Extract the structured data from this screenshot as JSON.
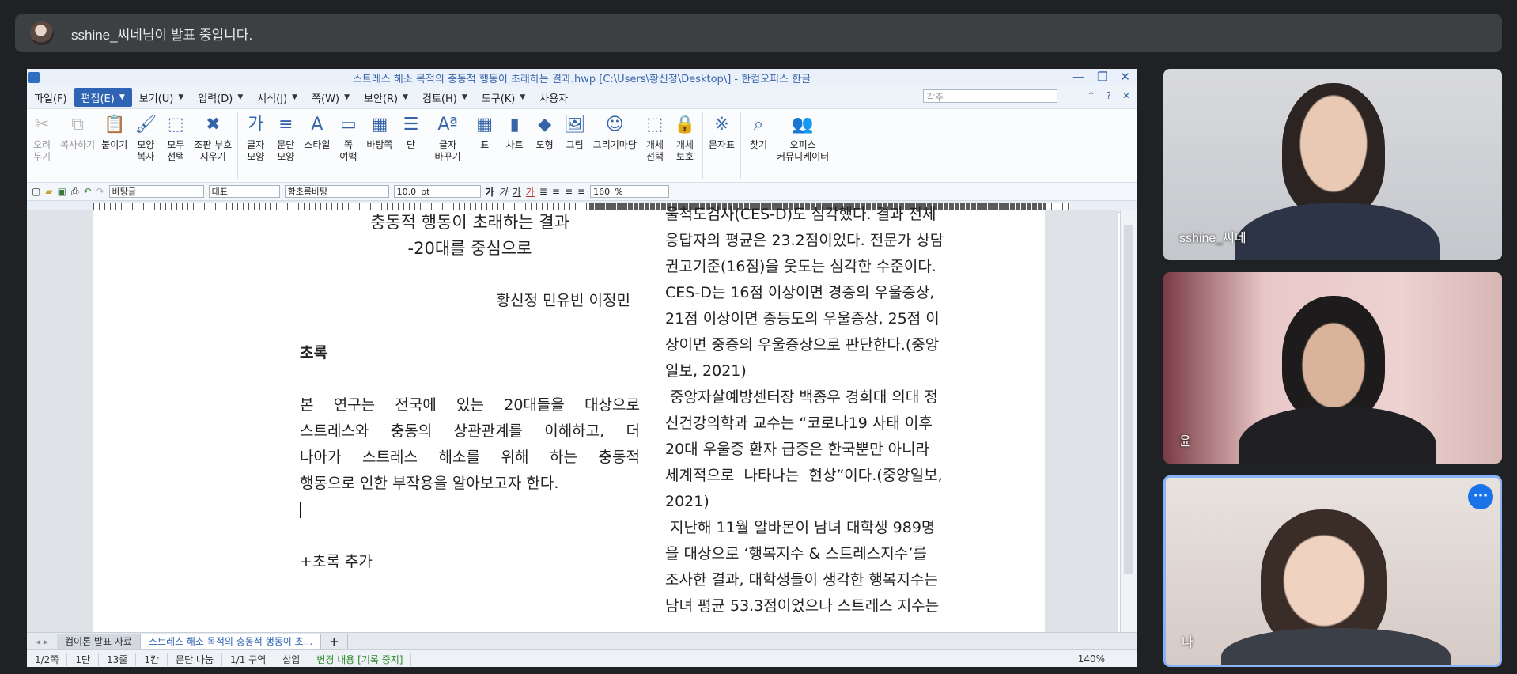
{
  "banner": {
    "text": "sshine_씨네님이 발표 중입니다."
  },
  "window": {
    "title": "스트레스 해소 목적의 충동적 행동이 초래하는 결과.hwp [C:\\Users\\황신정\\Desktop\\] - 한컴오피스 한글",
    "controls": [
      "—",
      "❐",
      "✕"
    ]
  },
  "menu": {
    "items": [
      "파일(F)",
      "편집(E)",
      "보기(U)",
      "입력(D)",
      "서식(J)",
      "쪽(W)",
      "보안(R)",
      "검토(H)",
      "도구(K)",
      "사용자"
    ],
    "search_placeholder": "각주",
    "mini": [
      "⌃",
      "?",
      "✕"
    ]
  },
  "ribbon": {
    "buttons": [
      {
        "label": "오려\n두기",
        "icon": "scissors-icon",
        "glyph": "✂",
        "disabled": true
      },
      {
        "label": "복사하기",
        "icon": "copy-icon",
        "glyph": "⧉",
        "disabled": true
      },
      {
        "label": "붙이기",
        "icon": "paste-icon",
        "glyph": "📋",
        "disabled": false
      },
      {
        "label": "모양\n복사",
        "icon": "format-painter-icon",
        "glyph": "🖌",
        "disabled": false
      },
      {
        "label": "모두\n선택",
        "icon": "select-all-icon",
        "glyph": "⬚",
        "disabled": false
      },
      {
        "label": "조판 부호\n지우기",
        "icon": "clear-marks-icon",
        "glyph": "✖",
        "disabled": false
      },
      {
        "label": "글자\n모양",
        "icon": "char-shape-icon",
        "glyph": "가",
        "disabled": false
      },
      {
        "label": "문단\n모양",
        "icon": "para-shape-icon",
        "glyph": "≡",
        "disabled": false
      },
      {
        "label": "스타일",
        "icon": "style-icon",
        "glyph": "A",
        "disabled": false
      },
      {
        "label": "쪽\n여백",
        "icon": "page-margin-icon",
        "glyph": "▭",
        "disabled": false
      },
      {
        "label": "바탕쪽",
        "icon": "master-page-icon",
        "glyph": "▦",
        "disabled": false
      },
      {
        "label": "단",
        "icon": "columns-icon",
        "glyph": "☰",
        "disabled": false
      },
      {
        "label": "글자\n바꾸기",
        "icon": "replace-char-icon",
        "glyph": "Aª",
        "disabled": false
      },
      {
        "label": "표",
        "icon": "table-icon",
        "glyph": "▦",
        "disabled": false
      },
      {
        "label": "차트",
        "icon": "chart-icon",
        "glyph": "▮",
        "disabled": false
      },
      {
        "label": "도형",
        "icon": "shape-icon",
        "glyph": "◆",
        "disabled": false
      },
      {
        "label": "그림",
        "icon": "picture-icon",
        "glyph": "🖼",
        "disabled": false
      },
      {
        "label": "그리기마당",
        "icon": "drawing-gallery-icon",
        "glyph": "☺",
        "disabled": false
      },
      {
        "label": "개체\n선택",
        "icon": "object-select-icon",
        "glyph": "⬚",
        "disabled": false
      },
      {
        "label": "개체\n보호",
        "icon": "object-protect-icon",
        "glyph": "🔒",
        "disabled": false
      },
      {
        "label": "문자표",
        "icon": "symbol-icon",
        "glyph": "※",
        "disabled": false
      },
      {
        "label": "찾기",
        "icon": "find-icon",
        "glyph": "⌕",
        "disabled": false
      },
      {
        "label": "오피스\n커뮤니케이터",
        "icon": "communicator-icon",
        "glyph": "👥",
        "disabled": false
      }
    ]
  },
  "format_bar": {
    "style": "바탕글",
    "lang": "대표",
    "font": "함초롬바탕",
    "size": "10.0",
    "unit": "pt",
    "zoom": "160",
    "zoom_unit": "%"
  },
  "document": {
    "left": {
      "title1": "충동적 행동이 초래하는 결과",
      "title2": "-20대를 중심으로",
      "authors": "황신정 민유빈 이정민",
      "abstract_heading": "초록",
      "abstract": [
        "본 연구는 전국에 있는 20대들을 대상으로",
        "스트레스와 충동의 상관관계를 이해하고, 더",
        "나아가 스트레스 해소를 위해 하는 충동적",
        "행동으로 인한 부작용을 알아보고자 한다."
      ],
      "add_note": "+초록 추가"
    },
    "right": [
      "울척도검사(CES-D)도 심각했다. 결과 전체",
      "응답자의 평균은 23.2점이었다. 전문가 상담",
      "권고기준(16점)을 웃도는 심각한 수준이다.",
      "CES-D는 16점 이상이면 경증의 우울증상,",
      "21점 이상이면 중등도의 우울증상, 25점 이",
      "상이면 중증의 우울증상으로 판단한다.(중앙",
      "일보, 2021)",
      " 중앙자살예방센터장 백종우 경희대 의대 정",
      "신건강의학과 교수는 “코로나19 사태 이후",
      "20대 우울증 환자 급증은 한국뿐만 아니라",
      "세계적으로  나타나는  현상”이다.(중앙일보,",
      "2021)",
      " 지난해 11월 알바몬이 남녀 대학생 989명",
      "을 대상으로 ‘행복지수 & 스트레스지수’를",
      "조사한 결과, 대학생들이 생각한 행복지수는",
      "남녀 평균 53.3점이었으나 스트레스 지수는"
    ]
  },
  "tabs": [
    "컴이론 발표 자료",
    "스트레스 해소 목적의 충동적 행동이 초...",
    "+"
  ],
  "status": {
    "items": [
      "1/2쪽",
      "1단",
      "13줄",
      "1칸",
      "문단 나눔",
      "1/1 구역",
      "삽입",
      "변경 내용 [기록 중지]"
    ],
    "zoom": "140%"
  },
  "participants": [
    {
      "name": "sshine_씨네"
    },
    {
      "name": "윤"
    },
    {
      "name": "나"
    }
  ],
  "colors": {
    "accent": "#2f64b4",
    "tile_highlight": "#8ab4f8",
    "meet_blue": "#1a73e8"
  }
}
